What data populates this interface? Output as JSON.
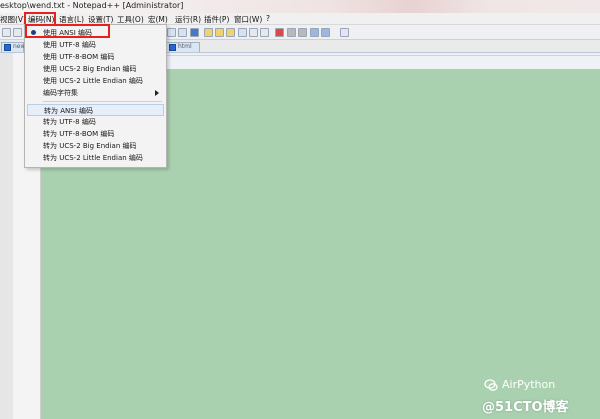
{
  "window": {
    "title": "esktop\\wend.txt - Notepad++ [Administrator]"
  },
  "menu": {
    "items": [
      {
        "label": "视图(V)"
      },
      {
        "label": "编码(N)"
      },
      {
        "label": "语言(L)"
      },
      {
        "label": "设置(T)"
      },
      {
        "label": "工具(O)"
      },
      {
        "label": "宏(M)"
      },
      {
        "label": "运行(R)"
      },
      {
        "label": "插件(P)"
      },
      {
        "label": "窗口(W)"
      },
      {
        "label": "?"
      }
    ]
  },
  "tabs": [
    {
      "label": "new"
    },
    {
      "label": "html"
    }
  ],
  "encoding_menu": {
    "items": [
      {
        "label": "使用 ANSI 编码",
        "checked": true
      },
      {
        "label": "使用 UTF-8 编码"
      },
      {
        "label": "使用 UTF-8-BOM 编码"
      },
      {
        "label": "使用 UCS-2 Big Endian 编码"
      },
      {
        "label": "使用 UCS-2 Little Endian 编码"
      },
      {
        "label": "编码字符集",
        "submenu": true
      },
      {
        "label": "转为 ANSI 编码",
        "hover": true
      },
      {
        "label": "转为 UTF-8 编码"
      },
      {
        "label": "转为 UTF-8-BOM 编码"
      },
      {
        "label": "转为 UCS-2 Big Endian 编码"
      },
      {
        "label": "转为 UCS-2 Little Endian 编码"
      }
    ]
  },
  "watermark": {
    "top": "AirPython",
    "bottom": "@51CTO博客"
  },
  "colors": {
    "editor_bg": "#a9d1b0",
    "highlight": "#e8211d",
    "menu_hover": "#e5eef9"
  }
}
